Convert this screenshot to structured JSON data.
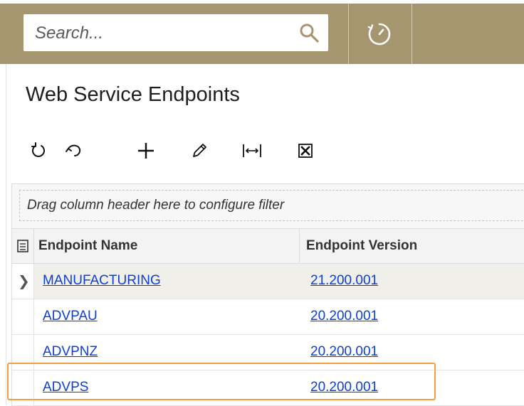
{
  "search": {
    "placeholder": "Search..."
  },
  "header": {
    "history_icon": "history-icon"
  },
  "page": {
    "title": "Web Service Endpoints"
  },
  "toolbar": {
    "items": [
      {
        "name": "refresh",
        "icon": "refresh-icon"
      },
      {
        "name": "undo",
        "icon": "undo-icon"
      },
      {
        "name": "add",
        "icon": "plus-icon"
      },
      {
        "name": "edit",
        "icon": "pencil-icon"
      },
      {
        "name": "fit-columns",
        "icon": "fit-width-icon"
      },
      {
        "name": "export-excel",
        "icon": "excel-icon"
      }
    ]
  },
  "grid": {
    "filter_hint": "Drag column header here to configure filter",
    "columns": [
      "Endpoint Name",
      "Endpoint Version"
    ],
    "rows": [
      {
        "name": "MANUFACTURING",
        "version": "21.200.001"
      },
      {
        "name": "ADVPAU",
        "version": "20.200.001"
      },
      {
        "name": "ADVPNZ",
        "version": "20.200.001"
      },
      {
        "name": "ADVPS",
        "version": "20.200.001"
      }
    ]
  },
  "colors": {
    "topbar": "#a69670",
    "link": "#0b3fd6",
    "highlight": "#f0a040"
  }
}
